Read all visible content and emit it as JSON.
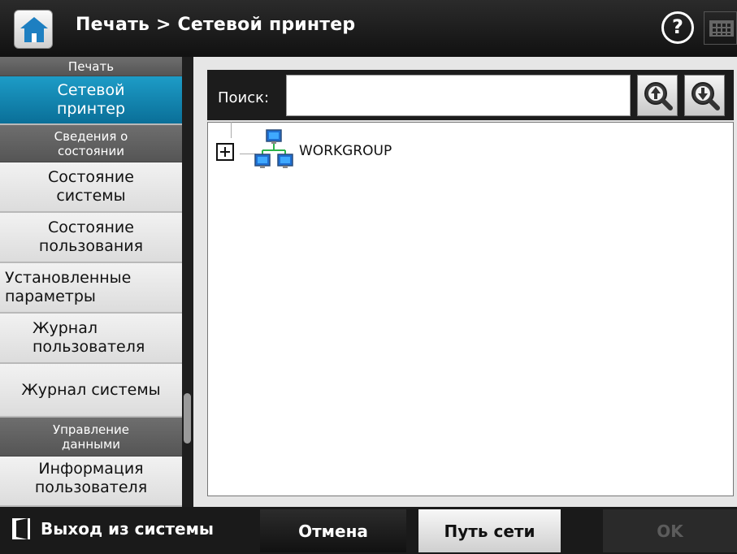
{
  "header": {
    "title": "Печать > Сетевой принтер",
    "home_icon": "home-icon",
    "help_label": "?",
    "keyboard_icon": "keyboard-icon"
  },
  "sidebar": {
    "items": [
      {
        "type": "category",
        "label": "Печать"
      },
      {
        "type": "item",
        "label": "Сетевой\nпринтер",
        "active": true
      },
      {
        "type": "category",
        "label": "Сведения о\nсостоянии"
      },
      {
        "type": "item",
        "label": "Состояние\nсистемы"
      },
      {
        "type": "item",
        "label": "Состояние\nпользования"
      },
      {
        "type": "item",
        "label": "Установленные\nпараметры"
      },
      {
        "type": "item",
        "label": "Журнал\nпользователя"
      },
      {
        "type": "item",
        "label": "Журнал системы"
      },
      {
        "type": "category",
        "label": "Управление\nданными"
      },
      {
        "type": "item",
        "label": "Информация\nпользователя"
      }
    ],
    "active_color": "#0a86b6"
  },
  "search": {
    "label": "Поиск:",
    "value": "",
    "placeholder": "",
    "search_up_icon": "search-up-icon",
    "search_down_icon": "search-down-icon"
  },
  "tree": {
    "nodes": [
      {
        "label": "WORKGROUP",
        "icon": "network-icon",
        "expanded": false
      }
    ]
  },
  "footer": {
    "logout_label": "Выход из системы",
    "cancel_label": "Отмена",
    "network_path_label": "Путь сети",
    "ok_label": "OK"
  }
}
